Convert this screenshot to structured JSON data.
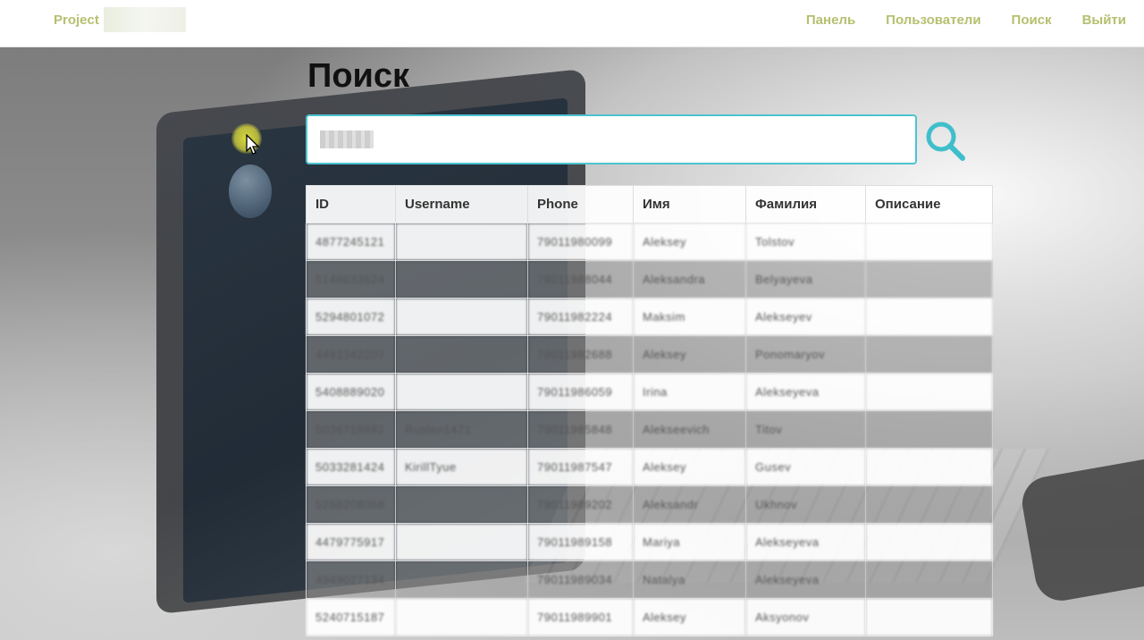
{
  "navbar": {
    "brand": "Project",
    "links": [
      "Панель",
      "Пользователи",
      "Поиск",
      "Выйти"
    ]
  },
  "page": {
    "title": "Поиск"
  },
  "search": {
    "value": ""
  },
  "table": {
    "headers": [
      "ID",
      "Username",
      "Phone",
      "Имя",
      "Фамилия",
      "Описание"
    ],
    "rows": [
      [
        "4877245121",
        "",
        "79011980099",
        "Aleksey",
        "Tolstov",
        ""
      ],
      [
        "5148633624",
        "",
        "79011988044",
        "Aleksandra",
        "Belyayeva",
        ""
      ],
      [
        "5294801072",
        "",
        "79011982224",
        "Maksim",
        "Alekseyev",
        ""
      ],
      [
        "4491342207",
        "",
        "79011982688",
        "Aleksey",
        "Ponomaryov",
        ""
      ],
      [
        "5408889020",
        "",
        "79011986059",
        "Irina",
        "Alekseyeva",
        ""
      ],
      [
        "5036718882",
        "Ruslan1471",
        "79011985848",
        "Alekseevich",
        "Titov",
        ""
      ],
      [
        "5033281424",
        "KirillTyue",
        "79011987547",
        "Aleksey",
        "Gusev",
        ""
      ],
      [
        "5288208068",
        "",
        "79011989202",
        "Aleksandr",
        "Ukhnov",
        ""
      ],
      [
        "4479775917",
        "",
        "79011989158",
        "Mariya",
        "Alekseyeva",
        ""
      ],
      [
        "4949027134",
        "",
        "79011989034",
        "Natalya",
        "Alekseyeva",
        ""
      ],
      [
        "5240715187",
        "",
        "79011989901",
        "Aleksey",
        "Aksyonov",
        ""
      ]
    ]
  },
  "colors": {
    "accent": "#b6c06f",
    "search_border": "#4cc3d0",
    "search_icon": "#3fbecb"
  },
  "icons": {
    "search": "search-icon",
    "cursor": "mouse-cursor-icon"
  }
}
